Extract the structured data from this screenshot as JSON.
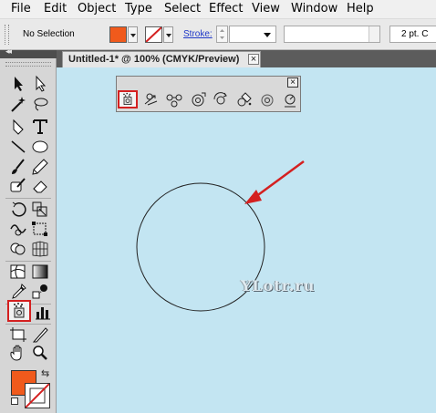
{
  "menu": {
    "items": [
      "File",
      "Edit",
      "Object",
      "Type",
      "Select",
      "Effect",
      "View",
      "Window",
      "Help"
    ]
  },
  "control_bar": {
    "selection_status": "No Selection",
    "fill_color": "#f05a1c",
    "stroke_label": "Stroke:",
    "brush_definition": "2 pt. C"
  },
  "document_tab": {
    "title": "Untitled-1* @ 100% (CMYK/Preview)",
    "close_glyph": "×"
  },
  "tools_panel": {
    "collapse_glyph": "◂◂",
    "active_tool": "symbol-sprayer-tool",
    "fill_color": "#f05a1c",
    "stroke_color": "none"
  },
  "symbolism_toolbar": {
    "close_glyph": "×",
    "tools": [
      "symbol-sprayer-tool",
      "symbol-shifter-tool",
      "symbol-scruncher-tool",
      "symbol-sizer-tool",
      "symbol-spinner-tool",
      "symbol-stainer-tool",
      "symbol-screener-tool",
      "symbol-styler-tool"
    ],
    "active_tool": "symbol-sprayer-tool"
  },
  "canvas": {
    "watermark": "YLotr.ru",
    "background_color": "#c3e5f2",
    "annotation_color": "#d42020"
  }
}
